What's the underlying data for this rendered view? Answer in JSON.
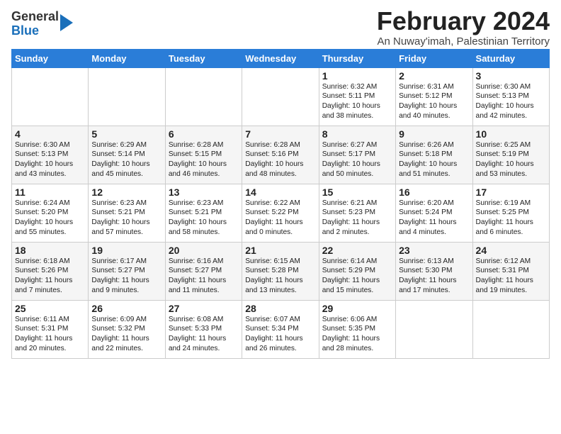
{
  "logo": {
    "general": "General",
    "blue": "Blue"
  },
  "title": "February 2024",
  "subtitle": "An Nuway'imah, Palestinian Territory",
  "headers": [
    "Sunday",
    "Monday",
    "Tuesday",
    "Wednesday",
    "Thursday",
    "Friday",
    "Saturday"
  ],
  "rows": [
    [
      {
        "day": "",
        "text": ""
      },
      {
        "day": "",
        "text": ""
      },
      {
        "day": "",
        "text": ""
      },
      {
        "day": "",
        "text": ""
      },
      {
        "day": "1",
        "text": "Sunrise: 6:32 AM\nSunset: 5:11 PM\nDaylight: 10 hours\nand 38 minutes."
      },
      {
        "day": "2",
        "text": "Sunrise: 6:31 AM\nSunset: 5:12 PM\nDaylight: 10 hours\nand 40 minutes."
      },
      {
        "day": "3",
        "text": "Sunrise: 6:30 AM\nSunset: 5:13 PM\nDaylight: 10 hours\nand 42 minutes."
      }
    ],
    [
      {
        "day": "4",
        "text": "Sunrise: 6:30 AM\nSunset: 5:13 PM\nDaylight: 10 hours\nand 43 minutes."
      },
      {
        "day": "5",
        "text": "Sunrise: 6:29 AM\nSunset: 5:14 PM\nDaylight: 10 hours\nand 45 minutes."
      },
      {
        "day": "6",
        "text": "Sunrise: 6:28 AM\nSunset: 5:15 PM\nDaylight: 10 hours\nand 46 minutes."
      },
      {
        "day": "7",
        "text": "Sunrise: 6:28 AM\nSunset: 5:16 PM\nDaylight: 10 hours\nand 48 minutes."
      },
      {
        "day": "8",
        "text": "Sunrise: 6:27 AM\nSunset: 5:17 PM\nDaylight: 10 hours\nand 50 minutes."
      },
      {
        "day": "9",
        "text": "Sunrise: 6:26 AM\nSunset: 5:18 PM\nDaylight: 10 hours\nand 51 minutes."
      },
      {
        "day": "10",
        "text": "Sunrise: 6:25 AM\nSunset: 5:19 PM\nDaylight: 10 hours\nand 53 minutes."
      }
    ],
    [
      {
        "day": "11",
        "text": "Sunrise: 6:24 AM\nSunset: 5:20 PM\nDaylight: 10 hours\nand 55 minutes."
      },
      {
        "day": "12",
        "text": "Sunrise: 6:23 AM\nSunset: 5:21 PM\nDaylight: 10 hours\nand 57 minutes."
      },
      {
        "day": "13",
        "text": "Sunrise: 6:23 AM\nSunset: 5:21 PM\nDaylight: 10 hours\nand 58 minutes."
      },
      {
        "day": "14",
        "text": "Sunrise: 6:22 AM\nSunset: 5:22 PM\nDaylight: 11 hours\nand 0 minutes."
      },
      {
        "day": "15",
        "text": "Sunrise: 6:21 AM\nSunset: 5:23 PM\nDaylight: 11 hours\nand 2 minutes."
      },
      {
        "day": "16",
        "text": "Sunrise: 6:20 AM\nSunset: 5:24 PM\nDaylight: 11 hours\nand 4 minutes."
      },
      {
        "day": "17",
        "text": "Sunrise: 6:19 AM\nSunset: 5:25 PM\nDaylight: 11 hours\nand 6 minutes."
      }
    ],
    [
      {
        "day": "18",
        "text": "Sunrise: 6:18 AM\nSunset: 5:26 PM\nDaylight: 11 hours\nand 7 minutes."
      },
      {
        "day": "19",
        "text": "Sunrise: 6:17 AM\nSunset: 5:27 PM\nDaylight: 11 hours\nand 9 minutes."
      },
      {
        "day": "20",
        "text": "Sunrise: 6:16 AM\nSunset: 5:27 PM\nDaylight: 11 hours\nand 11 minutes."
      },
      {
        "day": "21",
        "text": "Sunrise: 6:15 AM\nSunset: 5:28 PM\nDaylight: 11 hours\nand 13 minutes."
      },
      {
        "day": "22",
        "text": "Sunrise: 6:14 AM\nSunset: 5:29 PM\nDaylight: 11 hours\nand 15 minutes."
      },
      {
        "day": "23",
        "text": "Sunrise: 6:13 AM\nSunset: 5:30 PM\nDaylight: 11 hours\nand 17 minutes."
      },
      {
        "day": "24",
        "text": "Sunrise: 6:12 AM\nSunset: 5:31 PM\nDaylight: 11 hours\nand 19 minutes."
      }
    ],
    [
      {
        "day": "25",
        "text": "Sunrise: 6:11 AM\nSunset: 5:31 PM\nDaylight: 11 hours\nand 20 minutes."
      },
      {
        "day": "26",
        "text": "Sunrise: 6:09 AM\nSunset: 5:32 PM\nDaylight: 11 hours\nand 22 minutes."
      },
      {
        "day": "27",
        "text": "Sunrise: 6:08 AM\nSunset: 5:33 PM\nDaylight: 11 hours\nand 24 minutes."
      },
      {
        "day": "28",
        "text": "Sunrise: 6:07 AM\nSunset: 5:34 PM\nDaylight: 11 hours\nand 26 minutes."
      },
      {
        "day": "29",
        "text": "Sunrise: 6:06 AM\nSunset: 5:35 PM\nDaylight: 11 hours\nand 28 minutes."
      },
      {
        "day": "",
        "text": ""
      },
      {
        "day": "",
        "text": ""
      }
    ]
  ]
}
